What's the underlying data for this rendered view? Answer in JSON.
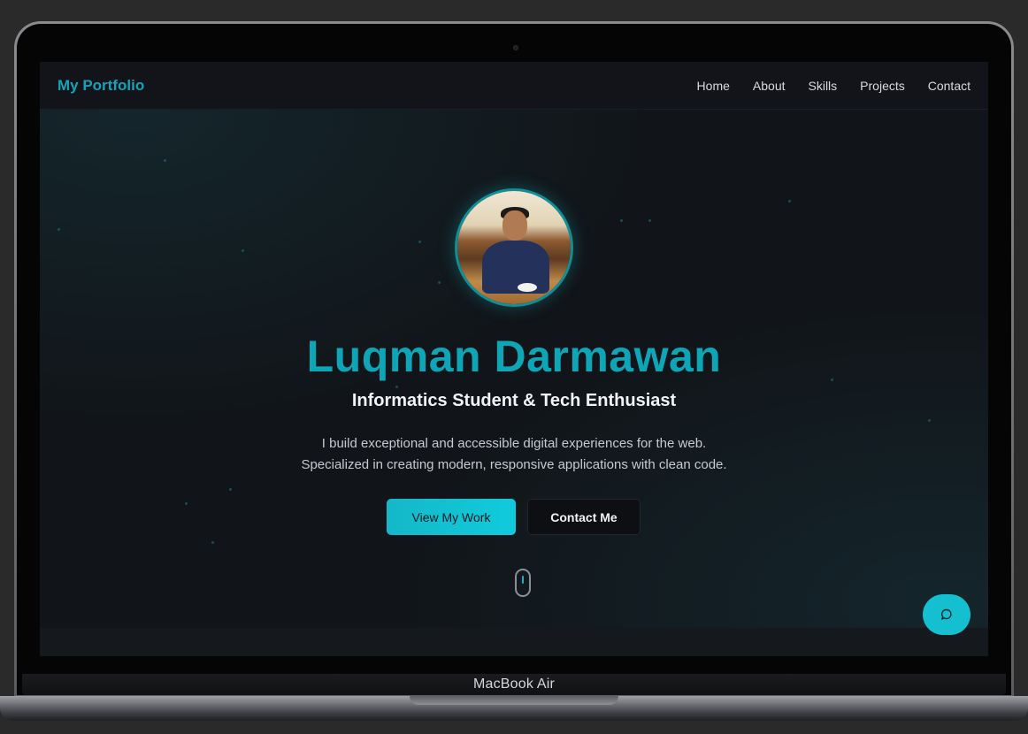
{
  "device": {
    "label": "MacBook Air"
  },
  "nav": {
    "brand": "My Portfolio",
    "links": [
      {
        "label": "Home"
      },
      {
        "label": "About"
      },
      {
        "label": "Skills"
      },
      {
        "label": "Projects"
      },
      {
        "label": "Contact"
      }
    ]
  },
  "hero": {
    "name": "Luqman Darmawan",
    "subtitle": "Informatics Student & Tech Enthusiast",
    "description_line1": "I build exceptional and accessible digital experiences for the web.",
    "description_line2": "Specialized in creating modern, responsive applications with clean code.",
    "primary_button": "View My Work",
    "secondary_button": "Contact Me"
  },
  "colors": {
    "accent": "#0ea5b7",
    "background": "#111418",
    "navbar": "#121419"
  },
  "icons": {
    "chat": "chat-bubble-icon",
    "scroll": "mouse-scroll-icon"
  }
}
